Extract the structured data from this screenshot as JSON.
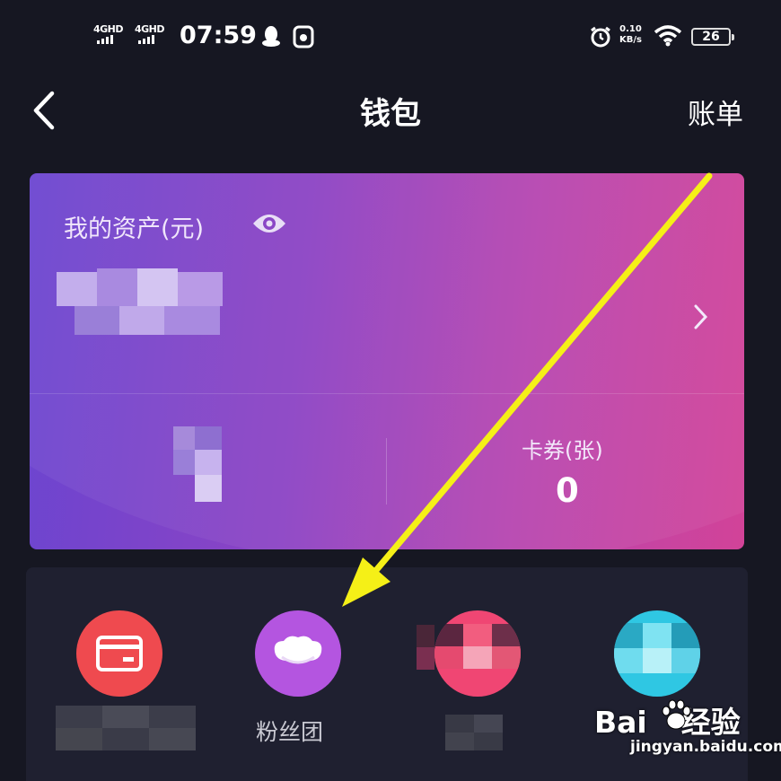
{
  "status_bar": {
    "network_1": "4GHD",
    "network_2": "4GHD",
    "time": "07:59",
    "speed_value": "0.10",
    "speed_unit": "KB/s",
    "battery": "26"
  },
  "nav": {
    "title": "钱包",
    "bill_label": "账单"
  },
  "asset_card": {
    "label": "我的资产(元)",
    "coupon_label": "卡券(张)",
    "coupon_value": "0"
  },
  "services": [
    {
      "icon": "card-icon",
      "color": "#ef4a4f",
      "label": ""
    },
    {
      "icon": "fan-club-icon",
      "color": "#b455e0",
      "label": "粉丝团"
    },
    {
      "icon": "blurred-icon",
      "color": "#f04673",
      "label": ""
    },
    {
      "icon": "blurred-icon",
      "color": "#2fc7e3",
      "label": ""
    }
  ],
  "watermark": {
    "brand_prefix": "Bai",
    "brand_suffix": "经验",
    "url": "jingyan.baidu.com"
  },
  "colors": {
    "background": "#161722",
    "card_gradient_start": "#6b45d0",
    "card_gradient_end": "#d24398",
    "arrow": "#f5f017"
  }
}
